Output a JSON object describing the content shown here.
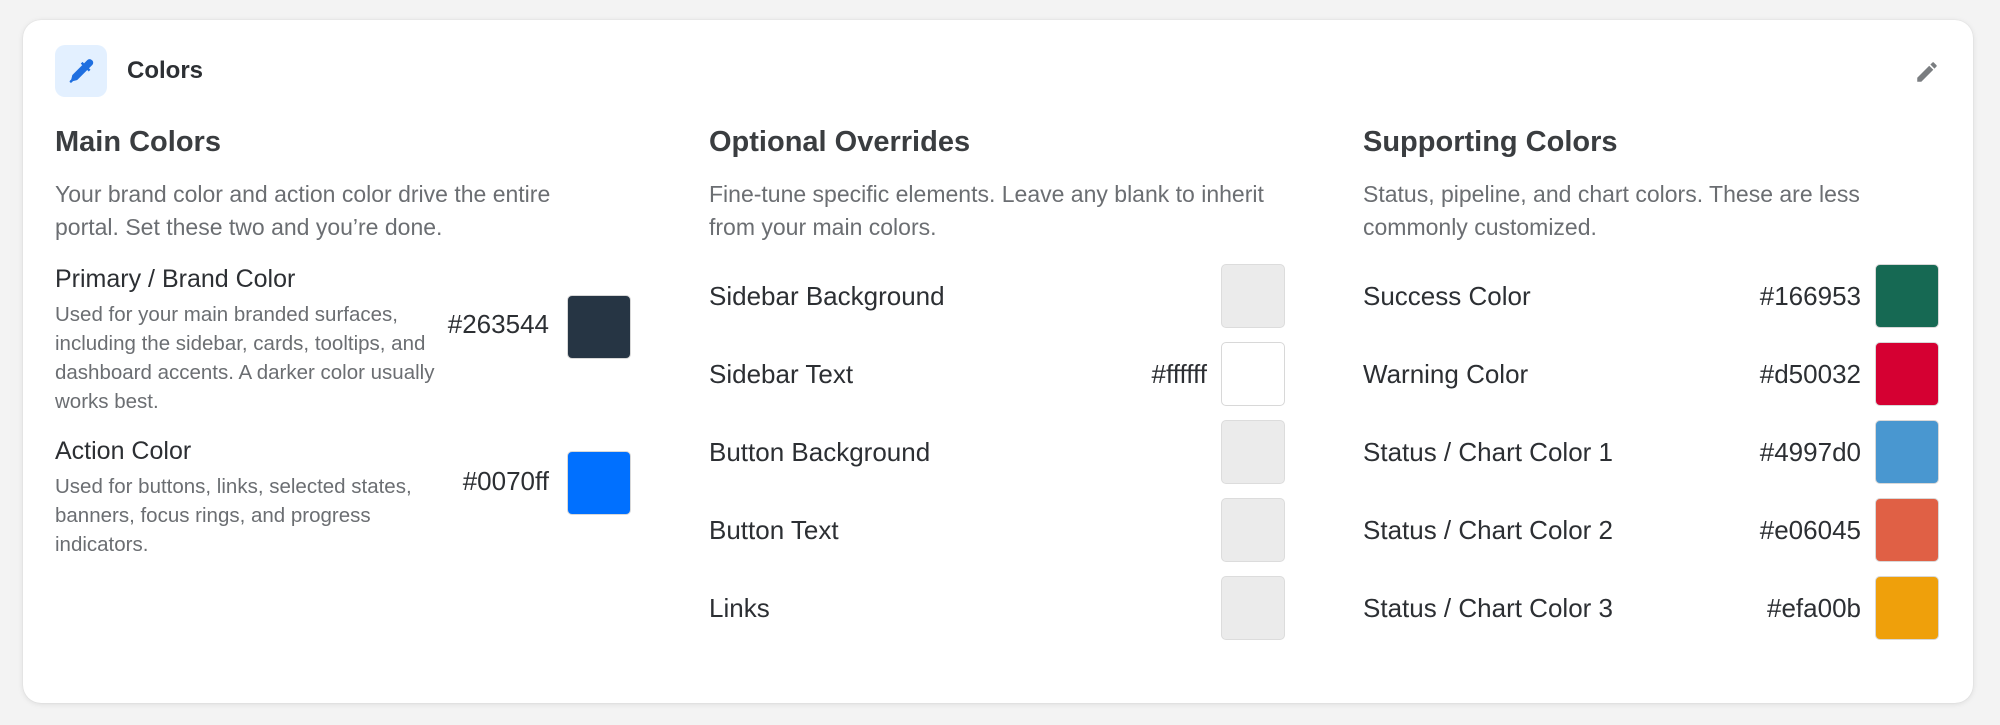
{
  "header": {
    "title": "Colors",
    "icon": "eyedropper-icon",
    "edit_icon": "pencil-icon"
  },
  "main": {
    "title": "Main Colors",
    "description": "Your brand color and action color drive the entire portal. Set these two and you’re done.",
    "items": [
      {
        "label": "Primary / Brand Color",
        "description": "Used for your main branded surfaces, including the sidebar, cards, tooltips, and dashboard accents. A darker color usually works best.",
        "value": "#263544",
        "color": "#263544"
      },
      {
        "label": "Action Color",
        "description": "Used for buttons, links, selected states, banners, focus rings, and progress indicators.",
        "value": "#0070ff",
        "color": "#0070ff"
      }
    ]
  },
  "overrides": {
    "title": "Optional Overrides",
    "description": "Fine-tune specific elements. Leave any blank to inherit from your main colors.",
    "items": [
      {
        "label": "Sidebar Background",
        "value": "",
        "color": ""
      },
      {
        "label": "Sidebar Text",
        "value": "#ffffff",
        "color": "#ffffff"
      },
      {
        "label": "Button Background",
        "value": "",
        "color": ""
      },
      {
        "label": "Button Text",
        "value": "",
        "color": ""
      },
      {
        "label": "Links",
        "value": "",
        "color": ""
      }
    ]
  },
  "supporting": {
    "title": "Supporting Colors",
    "description": "Status, pipeline, and chart colors. These are less commonly customized.",
    "items": [
      {
        "label": "Success Color",
        "value": "#166953",
        "color": "#166953"
      },
      {
        "label": "Warning Color",
        "value": "#d50032",
        "color": "#d50032"
      },
      {
        "label": "Status / Chart Color 1",
        "value": "#4997d0",
        "color": "#4997d0"
      },
      {
        "label": "Status / Chart Color 2",
        "value": "#e06045",
        "color": "#e06045"
      },
      {
        "label": "Status / Chart Color 3",
        "value": "#efa00b",
        "color": "#efa00b"
      }
    ]
  }
}
